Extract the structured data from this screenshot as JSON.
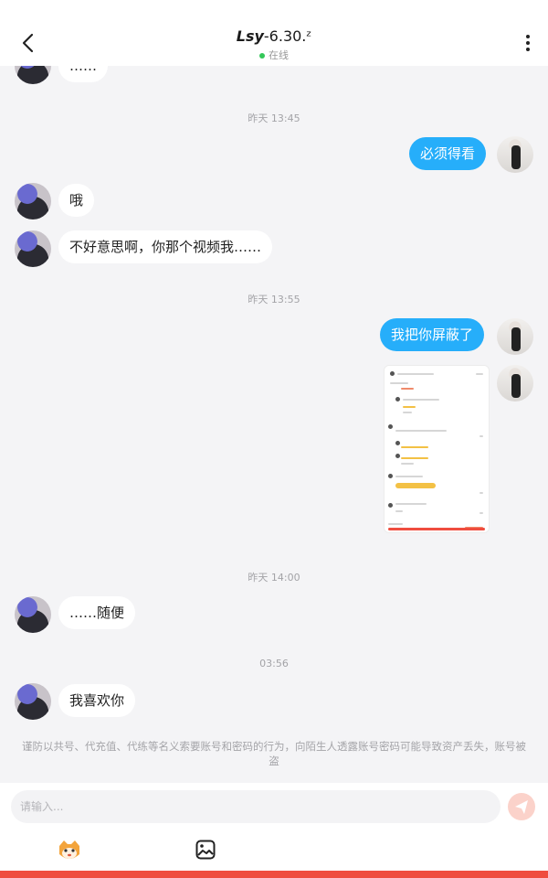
{
  "header": {
    "title_name": "Lsy",
    "title_suffix": "-6.30.ᶻ",
    "status": "在线"
  },
  "chat": {
    "truncated_message": "……",
    "time1": "昨天 13:45",
    "msg_out1": "必须得看",
    "msg_in1": "哦",
    "msg_in2": "不好意思啊，你那个视频我……",
    "time2": "昨天 13:55",
    "msg_out2": "我把你屏蔽了",
    "time3": "昨天 14:00",
    "msg_in3": "……随便",
    "time4": "03:56",
    "msg_in4": "我喜欢你"
  },
  "notice": "谨防以共号、代充值、代练等名义索要账号和密码的行为，向陌生人透露账号密码可能导致资产丢失，账号被盗",
  "input": {
    "placeholder": "请输入..."
  },
  "icons": [
    "back-arrow-icon",
    "more-vertical-icon",
    "send-icon",
    "emoji-mascot-icon",
    "image-icon"
  ],
  "colors": {
    "outgoing_bubble": "#26aefa",
    "online_dot": "#34c759",
    "accent_bar": "#ef4d3f"
  }
}
